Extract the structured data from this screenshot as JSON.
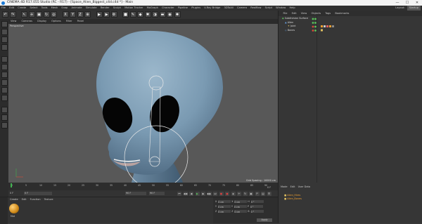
{
  "window": {
    "title": "CINEMA 4D R17.055 Studio (RC - R17) - [Space_Alien_Biggest_c4d.c4d *] - Main",
    "minimize": "—",
    "maximize": "☐",
    "close": "✕"
  },
  "menubar": {
    "items": [
      "File",
      "Edit",
      "Create",
      "Select",
      "Tools",
      "Mesh",
      "Snap",
      "Animate",
      "Simulate",
      "Render",
      "Sculpt",
      "Motion Tracker",
      "MoGraph",
      "Character",
      "Pipeline",
      "Plugins",
      "V-Ray Bridge",
      "3DToAll",
      "Camera",
      "Realflow",
      "Script",
      "Window",
      "Help"
    ],
    "layout_label": "Layout:",
    "layout_value": "Startup"
  },
  "toolbar": {
    "buttons": [
      {
        "name": "undo-icon",
        "glyph": "↶"
      },
      {
        "name": "redo-icon",
        "glyph": "↷"
      },
      {
        "name": "live-selection-icon",
        "glyph": "↖"
      },
      {
        "name": "move-icon",
        "glyph": "✛"
      },
      {
        "name": "scale-icon",
        "glyph": "▣"
      },
      {
        "name": "rotate-icon",
        "glyph": "↻"
      },
      {
        "name": "last-tool-icon",
        "glyph": "◎"
      },
      {
        "name": "x-axis-icon",
        "glyph": "X"
      },
      {
        "name": "y-axis-icon",
        "glyph": "Y"
      },
      {
        "name": "z-axis-icon",
        "glyph": "Z"
      },
      {
        "name": "coordinate-system-icon",
        "glyph": "⊕"
      },
      {
        "name": "render-active-view-icon",
        "glyph": "▶"
      },
      {
        "name": "render-to-picture-viewer-icon",
        "glyph": "▶"
      },
      {
        "name": "render-settings-icon",
        "glyph": "⚙"
      },
      {
        "name": "cube-icon",
        "glyph": "■"
      },
      {
        "name": "pen-icon",
        "glyph": "✎"
      },
      {
        "name": "subdivision-icon",
        "glyph": "◆"
      },
      {
        "name": "array-icon",
        "glyph": "✱"
      },
      {
        "name": "deformer-icon",
        "glyph": "◑"
      },
      {
        "name": "floor-icon",
        "glyph": "▬"
      },
      {
        "name": "camera-icon",
        "glyph": "◉"
      },
      {
        "name": "light-icon",
        "glyph": "✺"
      }
    ]
  },
  "left_tools": {
    "buttons": [
      "make-editable-icon",
      "model-mode-icon",
      "texture-mode-icon",
      "workplane-icon",
      "points-mode-icon",
      "edges-mode-icon",
      "polygons-mode-icon",
      "enable-axis-icon",
      "tweak-icon",
      "viewport-solo-icon",
      "snap-icon",
      "lock-workplane-icon",
      "sculpt-icon"
    ]
  },
  "viewport": {
    "menu": [
      "View",
      "Cameras",
      "Display",
      "Options",
      "Filter",
      "Panel"
    ],
    "label": "Perspective",
    "grid_spacing": "Grid Spacing : 10000 cm"
  },
  "object_manager": {
    "menu": [
      "File",
      "Edit",
      "View",
      "Objects",
      "Tags",
      "Bookmarks"
    ],
    "objects": [
      {
        "name": "Subdivision Surface",
        "color": "#58c45a"
      },
      {
        "name": "Alien",
        "color": "#6aa6e8"
      },
      {
        "name": "Joint",
        "color": "#e0c060"
      },
      {
        "name": "Bones",
        "color": "#6aa6e8"
      }
    ]
  },
  "timeline": {
    "ticks": [
      "0",
      "5",
      "10",
      "15",
      "20",
      "25",
      "30",
      "35",
      "40",
      "45",
      "50",
      "55",
      "60",
      "65",
      "70",
      "75",
      "80",
      "85",
      "90"
    ],
    "current_frame": "0 F",
    "start": "0 F",
    "end": "90 F",
    "end2": "90 F",
    "frame_indicator": "0 F"
  },
  "transport": {
    "buttons": [
      "go-to-start-icon",
      "previous-key-icon",
      "previous-frame-icon",
      "play-icon",
      "next-frame-icon",
      "next-key-icon",
      "go-to-end-icon",
      "record-icon",
      "autokey-icon",
      "keyframe-selection-icon",
      "position-key-icon",
      "rotation-key-icon",
      "scale-key-icon",
      "param-key-icon",
      "pla-key-icon",
      "timeline-icon"
    ]
  },
  "attributes": {
    "menu": [
      "Mode",
      "Edit",
      "User Data"
    ],
    "items": [
      {
        "name": "Alien_Hires",
        "color": "#e0c060"
      },
      {
        "name": "Alien_Bones",
        "color": "#e0c060"
      }
    ]
  },
  "material_manager": {
    "menu": [
      "Create",
      "Edit",
      "Function",
      "Texture"
    ],
    "material_name": "Mat"
  },
  "coordinates": {
    "rows": [
      {
        "label": "X",
        "value": "0 cm",
        "label2": "X",
        "value2": "0 cm",
        "label3": "H",
        "value3": "0 °"
      },
      {
        "label": "Y",
        "value": "0 cm",
        "label2": "Y",
        "value2": "0 cm",
        "label3": "P",
        "value3": "0 °"
      },
      {
        "label": "Z",
        "value": "0 cm",
        "label2": "Z",
        "value2": "0 cm",
        "label3": "B",
        "value3": "0 °"
      }
    ],
    "apply": "Apply"
  },
  "colors": {
    "alien_skin": "#7a9ab2",
    "viewport_bg": "#585858",
    "accent": "#f0a030"
  }
}
